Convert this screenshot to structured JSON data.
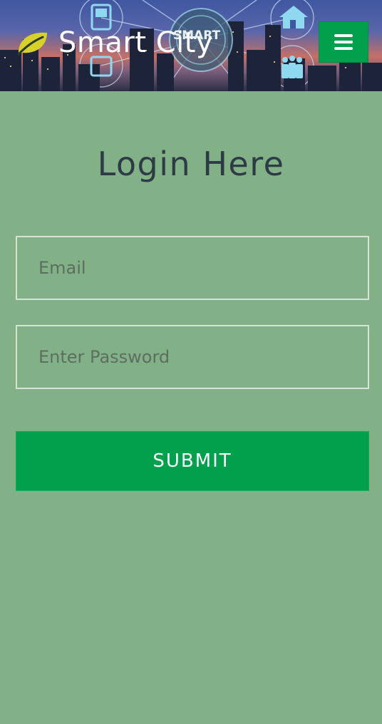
{
  "header": {
    "brand_name": "Smart City",
    "banner_text": "SMART",
    "menu_icon": "hamburger-icon",
    "brand_icon": "leaf-icon"
  },
  "login": {
    "title": "Login Here",
    "email_placeholder": "Email",
    "password_placeholder": "Enter Password",
    "submit_label": "SUBMIT"
  },
  "colors": {
    "page_background": "#83b187",
    "accent_green": "#00a04c",
    "leaf_yellow": "#d9d12b",
    "title_text": "#2e3a45"
  }
}
